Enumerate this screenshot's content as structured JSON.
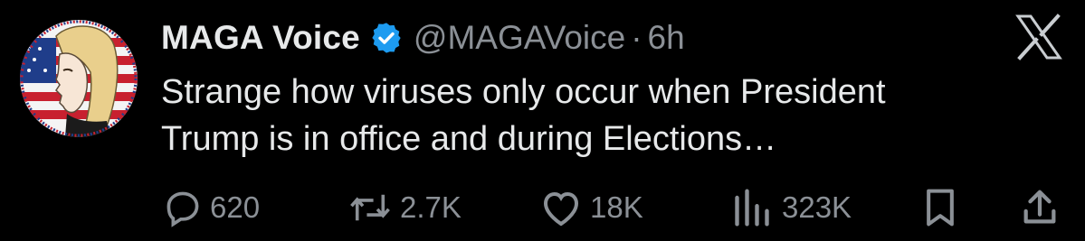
{
  "tweet": {
    "author": {
      "display_name": "MAGA Voice",
      "handle": "@MAGAVoice",
      "verified": true,
      "avatar": "avatar-illustration"
    },
    "separator": "·",
    "timestamp": "6h",
    "text_lines": [
      "Strange how viruses only occur when President",
      "Trump is in office and during Elections…"
    ],
    "platform_icon": "x-logo-icon"
  },
  "actions": {
    "replies": {
      "icon": "reply-icon",
      "count": "620"
    },
    "reposts": {
      "icon": "repost-icon",
      "count": "2.7K"
    },
    "likes": {
      "icon": "heart-icon",
      "count": "18K"
    },
    "views": {
      "icon": "views-icon",
      "count": "323K"
    },
    "bookmark": {
      "icon": "bookmark-icon"
    },
    "share": {
      "icon": "share-icon"
    }
  },
  "colors": {
    "background": "#000000",
    "primary_text": "#e7e9ea",
    "secondary_text": "#8b9096",
    "verified_badge": "#1d9bf0"
  }
}
